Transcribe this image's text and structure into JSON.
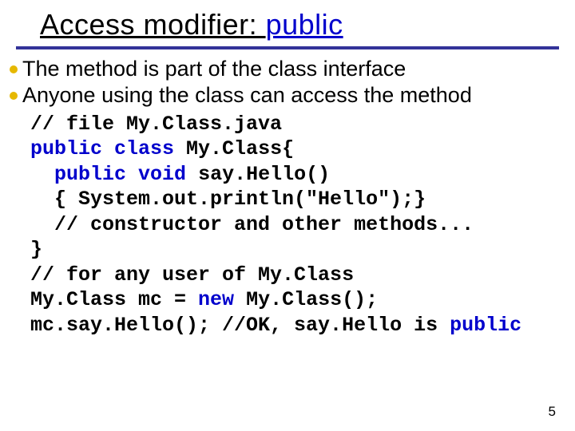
{
  "title": {
    "prefix": "Access modifier: ",
    "keyword": "public"
  },
  "bullets": [
    "The method is part of the class interface",
    "Anyone using the class can access the method"
  ],
  "code": {
    "l1a": "// file My.Class.java",
    "l2a": "public",
    "l2b": " ",
    "l2c": "class",
    "l2d": " My.Class{",
    "l3a": "  ",
    "l3b": "public",
    "l3c": " ",
    "l3d": "void",
    "l3e": " say.Hello()",
    "l4a": "  { System.out.println(\"Hello\");}",
    "l5a": "  // constructor and other methods...",
    "l6a": "}",
    "l7a": "// for any user of My.Class",
    "l8a": "My.Class mc = ",
    "l8b": "new",
    "l8c": " My.Class();",
    "l9a": "mc.say.Hello(); //OK, say.Hello is ",
    "l9b": "public"
  },
  "pagenum": "5"
}
